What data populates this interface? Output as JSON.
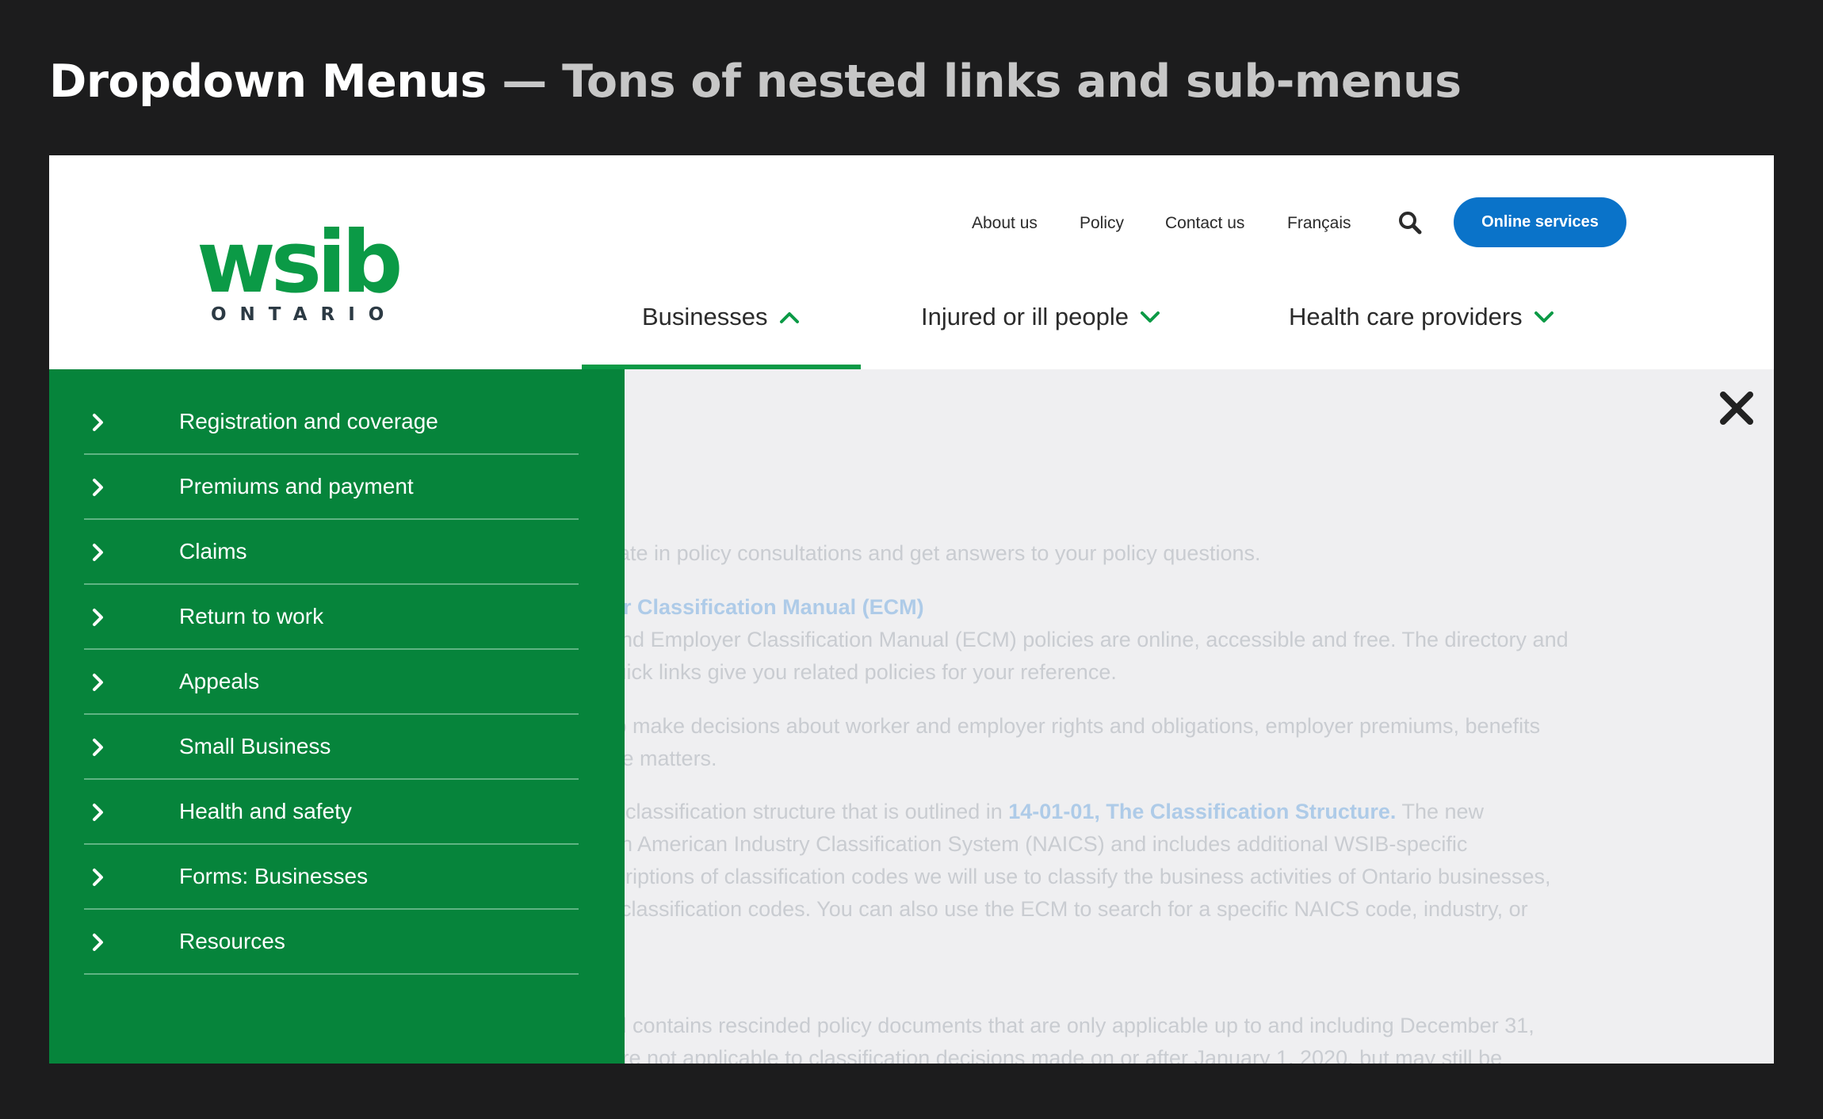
{
  "caption": {
    "lead": "Dropdown Menus",
    "rest": " — Tons of nested links and sub-menus"
  },
  "logo": {
    "word": "wsib",
    "sub": "ONTARIO"
  },
  "utility_nav": [
    "About us",
    "Policy",
    "Contact us",
    "Français"
  ],
  "search_icon": "search-icon",
  "online_services": "Online services",
  "main_nav": [
    {
      "label": "Businesses",
      "chevron": "up"
    },
    {
      "label": "Injured or ill people",
      "chevron": "down"
    },
    {
      "label": "Health care providers",
      "chevron": "down"
    }
  ],
  "colors": {
    "brand_green": "#0b9a46",
    "menu_green": "#06843b",
    "button_blue": "#0a73c9"
  },
  "menu": {
    "items": [
      "Registration and coverage",
      "Premiums and payment",
      "Claims",
      "Return to work",
      "Appeals",
      "Small Business",
      "Health and safety",
      "Forms: Businesses",
      "Resources"
    ]
  },
  "background_text": {
    "l1": "ticipate in policy consultations and get answers to your policy questions.",
    "l2": "loyer Classification Manual (ECM)",
    "l3": "es and Employer Classification Manual (ECM) policies are online, accessible and free. The directory and",
    "l4": "le quick links give you related policies for your reference.",
    "l5": "es to make decisions about worker and employer rights and obligations, employer premiums, benefits",
    "l6": "rance matters.",
    "l7a": "new classification structure that is outlined in ",
    "l7b": "14-01-01, The Classification Structure.",
    "l7c": " The new",
    "l8": "North American Industry Classification System (NAICS) and includes additional WSIB-specific",
    "l9": "descriptions of classification codes we will use to classify the business activities of Ontario businesses,",
    "l10": "ese classification codes. You can also use the ECM to search for a specific NAICS code, industry, or",
    "l11": "l and contains rescinded policy documents that are only applicable up to and including December 31,",
    "l12": "nd are not applicable to classification decisions made on or after January 1, 2020, but may still be"
  }
}
